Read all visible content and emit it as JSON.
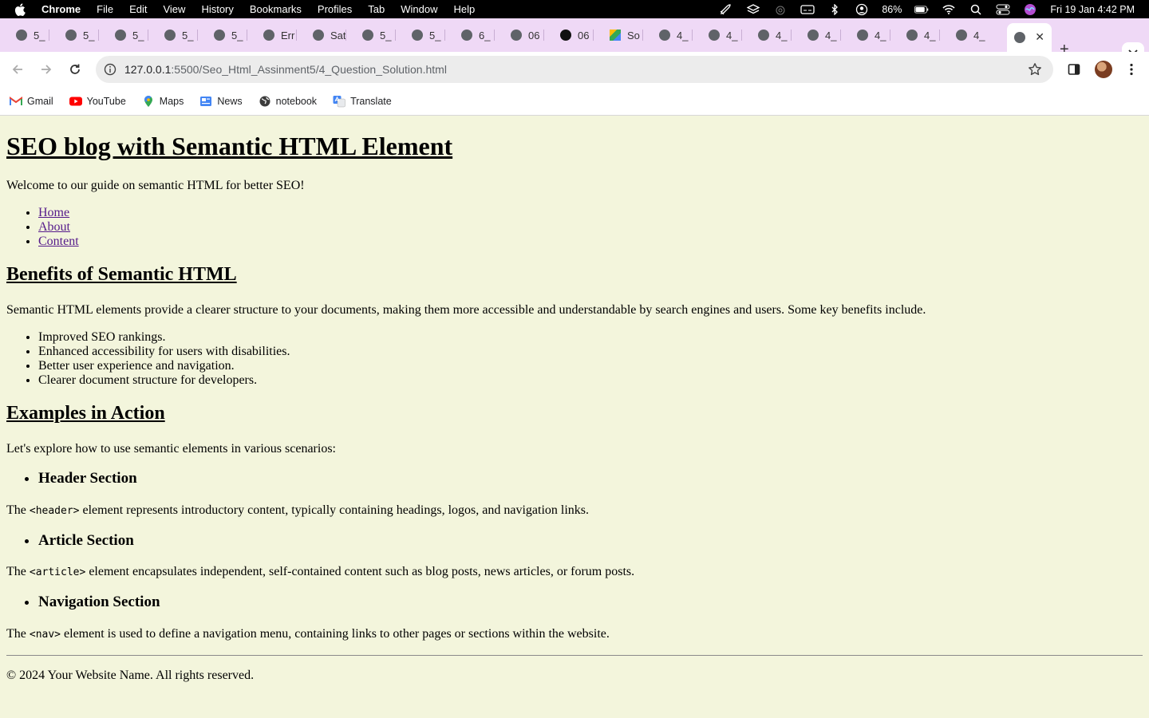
{
  "menubar": {
    "app_name": "Chrome",
    "items": [
      "File",
      "Edit",
      "View",
      "History",
      "Bookmarks",
      "Profiles",
      "Tab",
      "Window",
      "Help"
    ],
    "battery": "86%",
    "datetime": "Fri 19 Jan  4:42 PM"
  },
  "tabs": [
    {
      "label": "5_"
    },
    {
      "label": "5_"
    },
    {
      "label": "5_"
    },
    {
      "label": "5_"
    },
    {
      "label": "5_"
    },
    {
      "label": "Err"
    },
    {
      "label": "Sat"
    },
    {
      "label": "5_"
    },
    {
      "label": "5_"
    },
    {
      "label": "6_"
    },
    {
      "label": "06"
    },
    {
      "label": "06"
    },
    {
      "label": "So"
    },
    {
      "label": "4_"
    },
    {
      "label": "4_"
    },
    {
      "label": "4_"
    },
    {
      "label": "4_"
    },
    {
      "label": "4_"
    },
    {
      "label": "4_"
    },
    {
      "label": "4_"
    }
  ],
  "toolbar": {
    "url_host": "127.0.0.1",
    "url_rest": ":5500/Seo_Html_Assinment5/4_Question_Solution.html"
  },
  "bookmarks": [
    {
      "label": "Gmail",
      "icon": "gmail-icon"
    },
    {
      "label": "YouTube",
      "icon": "youtube-icon"
    },
    {
      "label": "Maps",
      "icon": "maps-icon"
    },
    {
      "label": "News",
      "icon": "news-icon"
    },
    {
      "label": "notebook",
      "icon": "globe-icon"
    },
    {
      "label": "Translate",
      "icon": "translate-icon"
    }
  ],
  "page": {
    "title": "SEO blog with Semantic HTML Element",
    "welcome": "Welcome to our guide on semantic HTML for better SEO!",
    "nav_links": [
      "Home",
      "About",
      "Content"
    ],
    "benefits_heading": "Benefits of Semantic HTML",
    "benefits_intro": "Semantic HTML elements provide a clearer structure to your documents, making them more accessible and understandable by search engines and users. Some key benefits include.",
    "benefits": [
      "Improved SEO rankings.",
      "Enhanced accessibility for users with disabilities.",
      "Better user experience and navigation.",
      "Clearer document structure for developers."
    ],
    "examples_heading": "Examples in Action",
    "examples_intro": "Let's explore how to use semantic elements in various scenarios:",
    "examples": [
      {
        "title": "Header Section",
        "pre": "The ",
        "code": "<header>",
        "post": " element represents introductory content, typically containing headings, logos, and navigation links."
      },
      {
        "title": "Article Section",
        "pre": "The ",
        "code": "<article>",
        "post": " element encapsulates independent, self-contained content such as blog posts, news articles, or forum posts."
      },
      {
        "title": "Navigation Section",
        "pre": "The ",
        "code": "<nav>",
        "post": " element is used to define a navigation menu, containing links to other pages or sections within the website."
      }
    ],
    "footer": "© 2024 Your Website Name. All rights reserved."
  }
}
